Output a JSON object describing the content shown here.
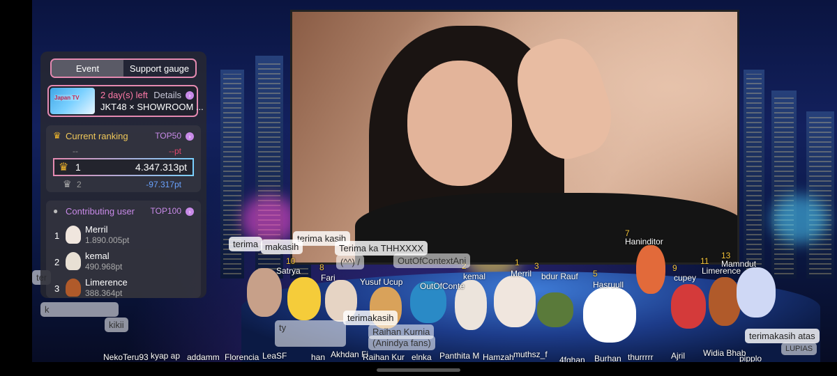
{
  "panel": {
    "tabs": [
      "Event",
      "Support gauge"
    ],
    "event": {
      "thumb_text": "Japan TV",
      "days_left": "2 day(s) left",
      "details": "Details",
      "name": "JKT48 × SHOWROOM ..."
    },
    "ranking": {
      "title": "Current ranking",
      "top_link": "TOP50",
      "prev_rank": "--",
      "prev_pts": "--pt",
      "my_rank": "1",
      "my_pts": "4.347.313pt",
      "next_rank": "2",
      "next_diff": "-97.317pt"
    },
    "contrib": {
      "title": "Contributing user",
      "top_link": "TOP100",
      "users": [
        {
          "rank": "1",
          "name": "Merril",
          "pts": "1.890.005pt"
        },
        {
          "rank": "2",
          "name": "kemal",
          "pts": "490.968pt"
        },
        {
          "rank": "3",
          "name": "Limerence",
          "pts": "388.364pt"
        }
      ]
    }
  },
  "chat": [
    {
      "text": "terima kasih"
    },
    {
      "text": "makasih"
    },
    {
      "text": "terima"
    },
    {
      "text": "Terima ka THHXXXX"
    },
    {
      "text": "(^^) /"
    },
    {
      "text": "OutOfContextAni"
    },
    {
      "text": "ter"
    },
    {
      "text": "k"
    },
    {
      "text": "kikii"
    },
    {
      "text": "ty"
    },
    {
      "text": "terimakasih"
    },
    {
      "text": "Raihan Kurnia"
    },
    {
      "text": "(Anindya fans)"
    },
    {
      "text": "terimakasih atas"
    },
    {
      "text": "LUPIAS"
    }
  ],
  "names": [
    "Satrya",
    "Fari",
    "Yusuf Ucup",
    "OutOfConte",
    "kemal",
    "Merril",
    "bdur Rauf",
    "Hasruull",
    "Haninditor",
    "cupey",
    "Limerence",
    "Mamndut",
    "NekoTeru93",
    "kyap ap",
    "addamm",
    "Florencia",
    "LeaSF",
    "han",
    "Akhdan Fi",
    "Raihan Kur",
    "elnka",
    "Panthita M",
    "Hamzah",
    "muthsz_f",
    "4fghan",
    "Burhan",
    "thurrrrr",
    "Ajril",
    "Widia Bhab",
    "pipplo"
  ],
  "counts": [
    "10",
    "8",
    "2",
    "1",
    "3",
    "5",
    "7",
    "9",
    "11",
    "13"
  ]
}
